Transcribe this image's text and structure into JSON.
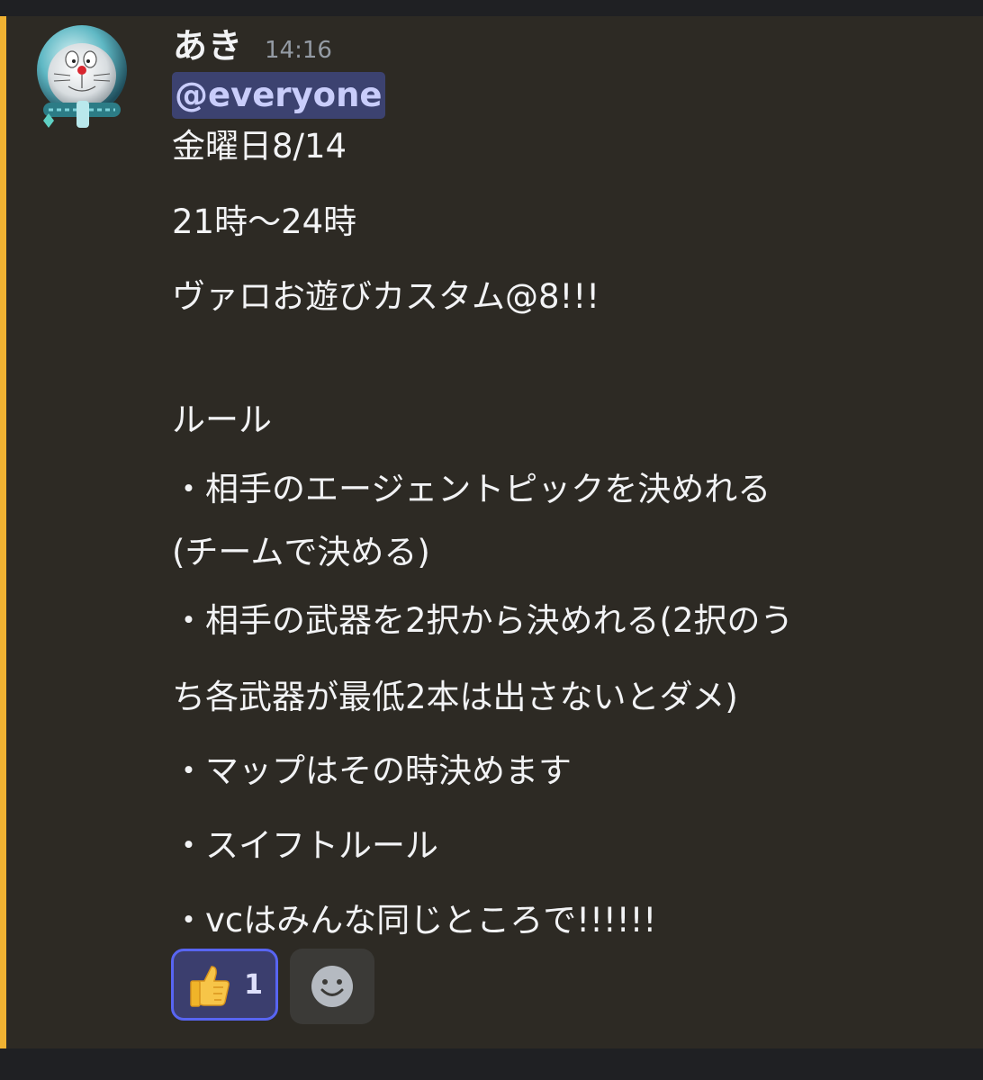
{
  "message": {
    "author": "あき",
    "timestamp": "14:16",
    "mention": "@everyone",
    "lines": [
      "金曜日8/14",
      "21時〜24時",
      "ヴァロお遊びカスタム@8!!!",
      "ルール",
      "・相手のエージェントピックを決めれる",
      "(チームで決める)",
      "・相手の武器を2択から決めれる(2択のう",
      "ち各武器が最低2本は出さないとダメ)",
      "・マップはその時決めます",
      "・スイフトルール",
      "・vcはみんな同じところで!!!!!!"
    ]
  },
  "reactions": [
    {
      "emoji": "thumbs-up-icon",
      "count": "1",
      "selected": true
    }
  ],
  "add_reaction": {
    "icon": "smiley-face-icon"
  },
  "colors": {
    "mention_highlight_bar": "#f0b232",
    "message_background": "#2d2a24",
    "mention_pill_background": "#3c4270",
    "mention_pill_text": "#c9cdfb",
    "reaction_border": "#5865f2",
    "reaction_background": "#3b3e6e"
  }
}
